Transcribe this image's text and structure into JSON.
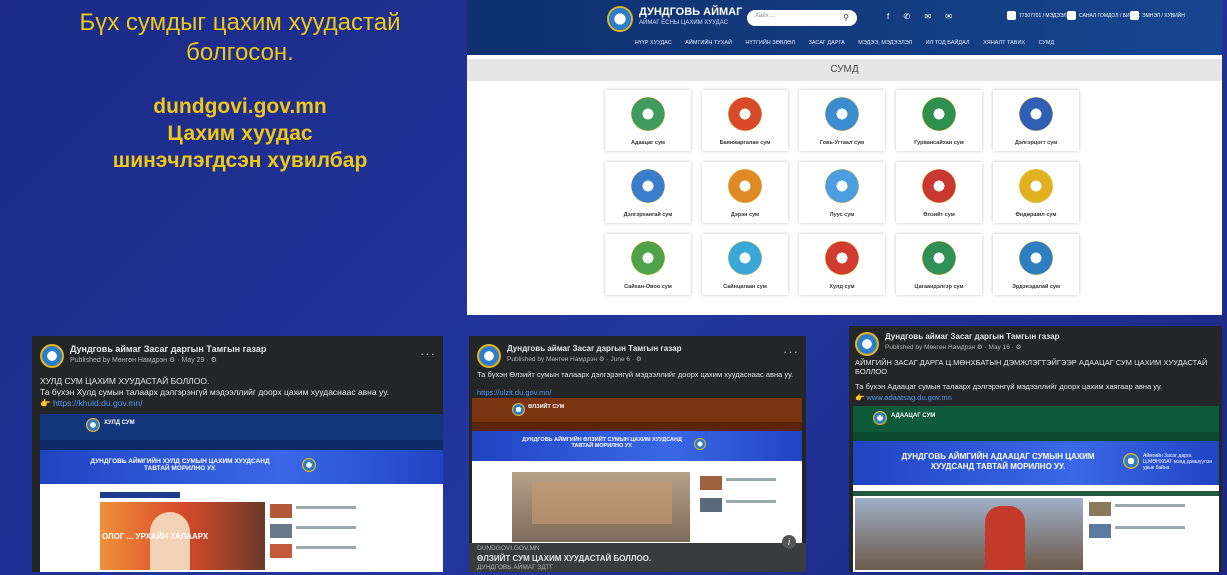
{
  "slide": {
    "title": "Бүх сумдыг цахим хуудастай болгосон.",
    "subtitle_line1": "dundgovi.gov.mn",
    "subtitle_line2": "Цахим хуудас",
    "subtitle_line3": "шинэчлэгдсэн хувилбар"
  },
  "site": {
    "name": "ДУНДГОВЬ АЙМАГ",
    "tagline": "АЙМАГ ЁСНЫ ЦАХИМ ХУУДАС",
    "search_placeholder": "Хайх ...",
    "search_icon": "search-icon",
    "social": "f ✆ ✉ ✉",
    "info": [
      "77307701 / МЭДЭЭЛЭЛ",
      "САНАЛ ГОМДОЛ / БИЧИХ",
      "ЭМНЭЛ / ХУВИЙН"
    ],
    "nav": [
      "НҮҮР ХУУДАС",
      "АЙМГИЙН ТУХАЙ",
      "НҮТГИЙН ЗӨВЛӨЛ",
      "ЗАСАГ ДАРГА",
      "МЭДЭЭ, МЭДЭЭЛЭЛ",
      "ИЛ ТОД БАЙДАЛ",
      "ХЯНАЛТ ТАВИХ",
      "СУМД"
    ],
    "section_title": "СУМД",
    "soums": [
      {
        "name": "Адаацаг сум",
        "color": "#3f9b5f"
      },
      {
        "name": "Баянжаргалан сум",
        "color": "#d94a2a"
      },
      {
        "name": "Говь-Угтаал сум",
        "color": "#3a8ed0"
      },
      {
        "name": "Гурвансайхан сум",
        "color": "#2e8f4f"
      },
      {
        "name": "Дэлгэрцогт сум",
        "color": "#2f5fb7"
      },
      {
        "name": "Дэлгэрхангай сум",
        "color": "#3a7ccd"
      },
      {
        "name": "Дэрэн сум",
        "color": "#e08a25"
      },
      {
        "name": "Луус сум",
        "color": "#4b9fe0"
      },
      {
        "name": "Өлзийт сум",
        "color": "#c8382e"
      },
      {
        "name": "Өндөршил сум",
        "color": "#e2b120"
      },
      {
        "name": "Сайхан-Овоо сум",
        "color": "#4ea34a"
      },
      {
        "name": "Сайнцагаан сум",
        "color": "#3aa7d9"
      },
      {
        "name": "Хулд сум",
        "color": "#d13a2e"
      },
      {
        "name": "Цагаандэлгэр сум",
        "color": "#2f8f55"
      },
      {
        "name": "Эрдэнэдалай сум",
        "color": "#2d7fc2"
      }
    ]
  },
  "posts": [
    {
      "page": "Дундговь аймаг Засаг даргын Тамгын газар",
      "meta": "Published by Мөнгөн Намдрэн ⚙ · May 29 · ⚙",
      "dots": "···",
      "text1": "ХУЛД СУМ ЦАХИМ ХУУДАСТАЙ БОЛЛОО.",
      "text2": "Та бүхэн Хулд сумын талаарх дэлгэрэнгүй мэдээллийг доорх цахим хуудаснаас авна уу.",
      "link": "👉 https://khuld.du.gov.mn/",
      "shot_name": "ХУЛД СУМ",
      "banner": "ДУНДГОВЬ АЙМГИЙН ХУЛД СУМЫН ЦАХИМ ХУУДСАНД ТАВТАЙ МОРИЛНО УУ.",
      "photo_caption": "ОЛОГ ... УРХАЙН ТАЛААРХ"
    },
    {
      "page": "Дундговь аймаг Засаг даргын Тамгын газар",
      "meta": "Published by Мөнгөн Намдрэн ⚙ · June 6 · ⚙",
      "dots": "···",
      "text1": "Та бүхэн Өлзийт сумын талаарх дэлгэрэнгүй мэдээллийг доорх цахим хуудаснаас авна уу.",
      "link": "https://ulzit.du.gov.mn/",
      "shot_name": "ӨЛЗИЙТ СУМ",
      "banner": "ДУНДГОВЬ АЙМГИЙН ӨЛЗИЙТ СУМЫН ЦАХИМ ХУУДСАНД ТАВТАЙ МОРИЛНО УУ.",
      "domain": "DUNDGOVI.GOV.MN",
      "link_title": "ӨЛЗИЙТ СУМ ЦАХИМ ХУУДАСТАЙ БОЛЛОО.",
      "link_sub": "ДУНДГОВЬ АЙМАГ ЗДТГ",
      "info_icon": "i"
    },
    {
      "page": "Дундговь аймаг Засаг даргын Тамгын газар",
      "meta": "Published by Мөнгөн Намдрэн ⚙ · May 16 · ⚙",
      "text1": "АЙМГИЙН ЗАСАГ ДАРГА Ц.МӨНХБАТЫН ДЭМЖЛЭГТЭЙГЭЭР АДААЦАГ СУМ ЦАХИМ ХУУДАСТАЙ БОЛЛОО",
      "text2": "Та бүхэн Адаацаг сумын талаарх дэлгэрэнгүй мэдээллийг доорх цахим хаягаар авна уу.",
      "link": "👉 www.adaatsag.du.gov.mn",
      "shot_name": "АДААЦАГ СУМ",
      "banner": "ДУНДГОВЬ АЙМГИЙН АДААЦАГ СУМЫН ЦАХИМ ХУУДСАНД ТАВТАЙ МОРИЛНО УУ.",
      "side": "Аймгийн Засаг дарга Ц.МӨНХБАТ мэнд дэвшүүлэн урьж байна"
    }
  ]
}
